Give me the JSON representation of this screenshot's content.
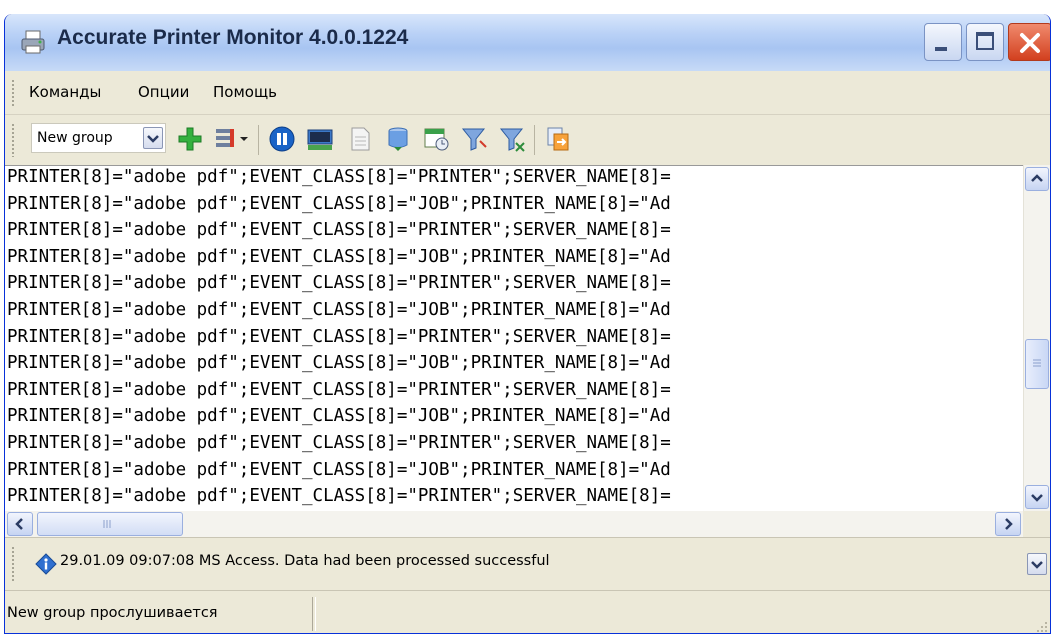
{
  "window": {
    "title": "Accurate Printer Monitor 4.0.0.1224",
    "app_icon": "printer-icon",
    "controls": [
      "minimize-icon",
      "maximize-icon",
      "close-icon"
    ]
  },
  "menu": {
    "items": [
      "Команды",
      "Опции",
      "Помощь"
    ]
  },
  "toolbar": {
    "group_select": "New group",
    "buttons": [
      {
        "icon": "add-icon"
      },
      {
        "icon": "columns-dropdown-icon"
      },
      {
        "icon": "pause-icon"
      },
      {
        "icon": "terminal-icon"
      },
      {
        "icon": "document-icon"
      },
      {
        "icon": "database-icon"
      },
      {
        "icon": "calendar-clock-icon"
      },
      {
        "icon": "filter-icon"
      },
      {
        "icon": "filter-clear-icon"
      },
      {
        "icon": "export-icon"
      }
    ]
  },
  "log": {
    "lines": [
      "PRINTER[8]=\"adobe pdf\";EVENT_CLASS[8]=\"PRINTER\";SERVER_NAME[8]=",
      "PRINTER[8]=\"adobe pdf\";EVENT_CLASS[8]=\"JOB\";PRINTER_NAME[8]=\"Ad",
      "PRINTER[8]=\"adobe pdf\";EVENT_CLASS[8]=\"PRINTER\";SERVER_NAME[8]=",
      "PRINTER[8]=\"adobe pdf\";EVENT_CLASS[8]=\"JOB\";PRINTER_NAME[8]=\"Ad",
      "PRINTER[8]=\"adobe pdf\";EVENT_CLASS[8]=\"PRINTER\";SERVER_NAME[8]=",
      "PRINTER[8]=\"adobe pdf\";EVENT_CLASS[8]=\"JOB\";PRINTER_NAME[8]=\"Ad",
      "PRINTER[8]=\"adobe pdf\";EVENT_CLASS[8]=\"PRINTER\";SERVER_NAME[8]=",
      "PRINTER[8]=\"adobe pdf\";EVENT_CLASS[8]=\"JOB\";PRINTER_NAME[8]=\"Ad",
      "PRINTER[8]=\"adobe pdf\";EVENT_CLASS[8]=\"PRINTER\";SERVER_NAME[8]=",
      "PRINTER[8]=\"adobe pdf\";EVENT_CLASS[8]=\"JOB\";PRINTER_NAME[8]=\"Ad",
      "PRINTER[8]=\"adobe pdf\";EVENT_CLASS[8]=\"PRINTER\";SERVER_NAME[8]=",
      "PRINTER[8]=\"adobe pdf\";EVENT_CLASS[8]=\"JOB\";PRINTER_NAME[8]=\"Ad",
      "PRINTER[8]=\"adobe pdf\";EVENT_CLASS[8]=\"PRINTER\";SERVER_NAME[8]="
    ]
  },
  "notification": {
    "icon": "info-icon",
    "text": "29.01.09 09:07:08 MS Access. Data had been processed successful"
  },
  "status": {
    "text": "New group прослушивается"
  },
  "colors": {
    "titlebar": "#b9d1f6",
    "chrome": "#ECE9D8",
    "close_button": "#d2401f",
    "content_bg": "#ffffff"
  }
}
